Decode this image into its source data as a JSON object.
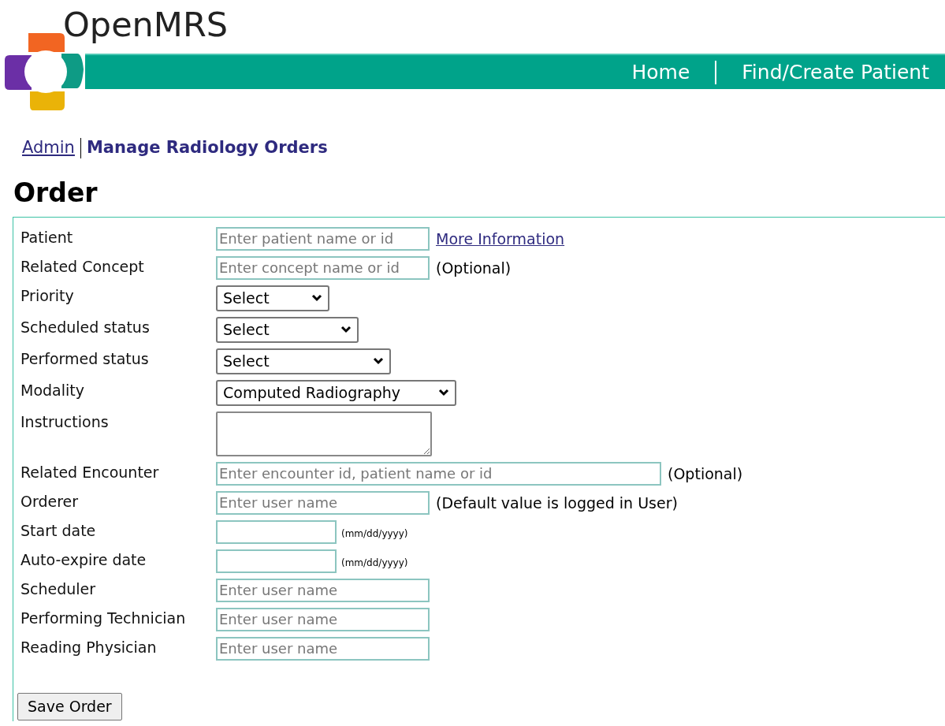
{
  "header": {
    "logo_text": "OpenMRS",
    "nav": [
      {
        "label": "Home"
      },
      {
        "label": "Find/Create Patient"
      }
    ]
  },
  "breadcrumb": {
    "link": "Admin",
    "current": "Manage Radiology Orders"
  },
  "title": "Order",
  "fields": [
    {
      "kind": "text",
      "label": "Patient",
      "placeholder": "Enter patient name or id",
      "link": "More Information"
    },
    {
      "kind": "text",
      "label": "Related Concept",
      "placeholder": "Enter concept name or id",
      "note": "(Optional)"
    },
    {
      "kind": "select",
      "label": "Priority",
      "value": "Select"
    },
    {
      "kind": "select",
      "label": "Scheduled status",
      "value": "Select"
    },
    {
      "kind": "select",
      "label": "Performed status",
      "value": "Select"
    },
    {
      "kind": "select",
      "label": "Modality",
      "value": "Computed Radiography"
    },
    {
      "kind": "textarea",
      "label": "Instructions"
    },
    {
      "kind": "text",
      "label": "Related Encounter",
      "placeholder": "Enter encounter id, patient name or id",
      "note": "(Optional)"
    },
    {
      "kind": "text",
      "label": "Orderer",
      "placeholder": "Enter user name",
      "note": "(Default value is logged in User)"
    },
    {
      "kind": "date",
      "label": "Start date",
      "hint": "(mm/dd/yyyy)"
    },
    {
      "kind": "date",
      "label": "Auto-expire date",
      "hint": "(mm/dd/yyyy)"
    },
    {
      "kind": "text",
      "label": "Scheduler",
      "placeholder": "Enter user name"
    },
    {
      "kind": "text",
      "label": "Performing Technician",
      "placeholder": "Enter user name"
    },
    {
      "kind": "text",
      "label": "Reading Physician",
      "placeholder": "Enter user name"
    }
  ],
  "save_button": "Save Order"
}
